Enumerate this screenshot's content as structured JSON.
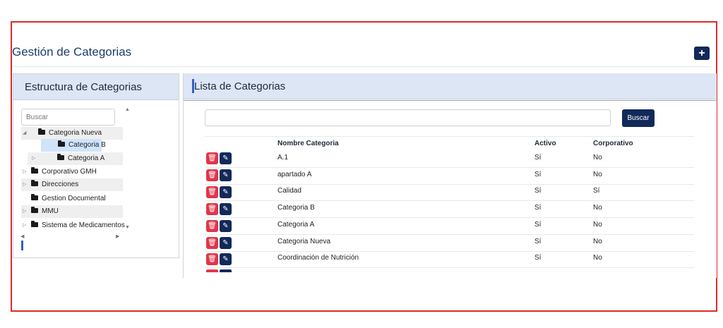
{
  "page": {
    "title": "Gestión de Categorias",
    "add_button_icon": "plus-icon"
  },
  "tree_panel": {
    "title": "Estructura de Categorias",
    "search_placeholder": "Buscar",
    "nodes": [
      {
        "label": "Categoria Nueva",
        "expanded": true
      },
      {
        "label": "Categoria B",
        "selected": true
      },
      {
        "label": "Categoria A"
      },
      {
        "label": "Corporativo GMH"
      },
      {
        "label": "Direcciones"
      },
      {
        "label": "Gestion Documental"
      },
      {
        "label": "MMU"
      },
      {
        "label": "Sistema de Medicamentos"
      }
    ]
  },
  "list_panel": {
    "title": "Lista de Categorias",
    "search_value": "",
    "search_button": "Buscar",
    "columns": [
      "Nombre Categoria",
      "Activo",
      "Corporativo"
    ],
    "rows": [
      {
        "name": "A.1",
        "activo": "Sí",
        "corporativo": "No"
      },
      {
        "name": "apartado A",
        "activo": "Sí",
        "corporativo": "No"
      },
      {
        "name": "Calidad",
        "activo": "Sí",
        "corporativo": "Sí"
      },
      {
        "name": "Categoria B",
        "activo": "Sí",
        "corporativo": "No"
      },
      {
        "name": "Categoria A",
        "activo": "Sí",
        "corporativo": "No"
      },
      {
        "name": "Categoria Nueva",
        "activo": "Sí",
        "corporativo": "No"
      },
      {
        "name": "Coordinación de Nutrición",
        "activo": "Sí",
        "corporativo": "No"
      }
    ]
  },
  "colors": {
    "header_bg": "#dde6f5",
    "primary": "#12295a",
    "danger": "#e0364a",
    "accent": "#2f62c9",
    "frame": "#e02a2a"
  }
}
